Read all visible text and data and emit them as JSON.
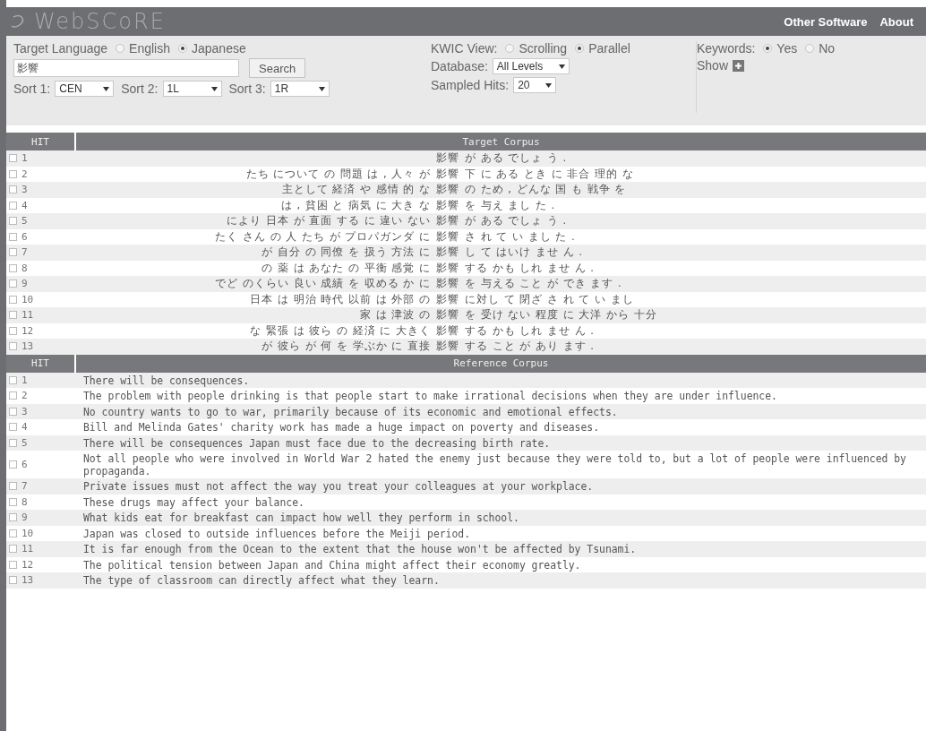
{
  "app": {
    "logo": "WebSCoRE",
    "nav": [
      {
        "label": "Other Software"
      },
      {
        "label": "About"
      }
    ]
  },
  "controls": {
    "target_language": {
      "label": "Target Language",
      "options": [
        {
          "label": "English",
          "selected": false
        },
        {
          "label": "Japanese",
          "selected": true
        }
      ]
    },
    "search": {
      "value": "影響",
      "button": "Search"
    },
    "sorts": [
      {
        "label": "Sort 1:",
        "value": "CEN"
      },
      {
        "label": "Sort 2:",
        "value": "1L"
      },
      {
        "label": "Sort 3:",
        "value": "1R"
      }
    ],
    "kwic_view": {
      "label": "KWIC View:",
      "options": [
        {
          "label": "Scrolling",
          "selected": false
        },
        {
          "label": "Parallel",
          "selected": true
        }
      ]
    },
    "database": {
      "label": "Database:",
      "value": "All Levels"
    },
    "sampled_hits": {
      "label": "Sampled Hits:",
      "value": "20"
    },
    "keywords": {
      "label": "Keywords:",
      "options": [
        {
          "label": "Yes",
          "selected": true
        },
        {
          "label": "No",
          "selected": false
        }
      ]
    },
    "show": {
      "label": "Show"
    }
  },
  "target_table": {
    "columns": [
      "HIT",
      "Target Corpus"
    ],
    "rows": [
      {
        "hit": "1",
        "checked": false,
        "keyword": "影響",
        "right": "が ある でしょ う ."
      },
      {
        "hit": "2",
        "checked": false,
        "left": "たち について の 問題 は , 人々 が",
        "keyword": "影響",
        "right": "下 に ある とき に 非合 理的 な"
      },
      {
        "hit": "3",
        "checked": false,
        "left": "主として 経済 や 感情 的 な",
        "keyword": "影響",
        "right": "の ため , どんな 国 も 戦争 を"
      },
      {
        "hit": "4",
        "checked": false,
        "left": "は , 貧困 と 病気 に 大き な",
        "keyword": "影響",
        "right": "を 与え まし た ."
      },
      {
        "hit": "5",
        "checked": false,
        "left": "により 日本 が 直面 する に 違い ない",
        "keyword": "影響",
        "right": "が ある でしょ う ."
      },
      {
        "hit": "6",
        "checked": false,
        "left": "たく さん の 人 たち が プロパガンダ に",
        "keyword": "影響",
        "right": "さ れ て い まし た ."
      },
      {
        "hit": "7",
        "checked": false,
        "left": "が 自分 の 同僚 を 扱う 方法 に",
        "keyword": "影響",
        "right": "し て はいけ ませ ん ."
      },
      {
        "hit": "8",
        "checked": false,
        "left": "の 薬 は あなた の 平衡 感覚 に",
        "keyword": "影響",
        "right": "する かも しれ ませ ん ."
      },
      {
        "hit": "9",
        "checked": false,
        "left": "でど のくらい 良い 成績 を 収める か に",
        "keyword": "影響",
        "right": "を 与える こと が でき ます ."
      },
      {
        "hit": "10",
        "checked": false,
        "left": "日本 は 明治 時代 以前 は 外部 の",
        "keyword": "影響",
        "right": "に対し て 閉ざ さ れ て い まし"
      },
      {
        "hit": "11",
        "checked": false,
        "left": "家 は 津波 の",
        "keyword": "影響",
        "right": "を 受け ない 程度 に 大洋 から 十分"
      },
      {
        "hit": "12",
        "checked": false,
        "left": "な 緊張 は 彼ら の 経済 に 大きく",
        "keyword": "影響",
        "right": "する かも しれ ませ ん ."
      },
      {
        "hit": "13",
        "checked": false,
        "left": "が 彼ら が 何 を 学ぶか に 直接",
        "keyword": "影響",
        "right": "する こと が あり ます ."
      }
    ]
  },
  "reference_table": {
    "columns": [
      "HIT",
      "Reference Corpus"
    ],
    "rows": [
      {
        "hit": "1",
        "checked": false,
        "text": "There will be consequences."
      },
      {
        "hit": "2",
        "checked": false,
        "text": "The problem with people drinking is that people start to make irrational decisions when they are under influence."
      },
      {
        "hit": "3",
        "checked": false,
        "text": "No country wants to go to war, primarily because of its economic and emotional effects."
      },
      {
        "hit": "4",
        "checked": false,
        "text": "Bill and Melinda Gates' charity work has made a huge impact on poverty and diseases."
      },
      {
        "hit": "5",
        "checked": false,
        "text": "There will be consequences Japan must face due to the decreasing birth rate."
      },
      {
        "hit": "6",
        "checked": false,
        "text": "Not all people who were involved in World War 2 hated the enemy just because they were told to, but a lot of people were influenced by propaganda."
      },
      {
        "hit": "7",
        "checked": false,
        "text": "Private issues must not affect the way you treat your colleagues at your workplace."
      },
      {
        "hit": "8",
        "checked": false,
        "text": "These drugs may affect your balance."
      },
      {
        "hit": "9",
        "checked": false,
        "text": "What kids eat for breakfast can impact how well they perform in school."
      },
      {
        "hit": "10",
        "checked": false,
        "text": "Japan was closed to outside influences before the Meiji period."
      },
      {
        "hit": "11",
        "checked": false,
        "text": "It is far enough from the Ocean to the extent that the house won't be affected by Tsunami."
      },
      {
        "hit": "12",
        "checked": false,
        "text": "The political tension between Japan and China might affect their economy greatly."
      },
      {
        "hit": "13",
        "checked": false,
        "text": "The type of classroom can directly affect what they learn."
      }
    ]
  }
}
